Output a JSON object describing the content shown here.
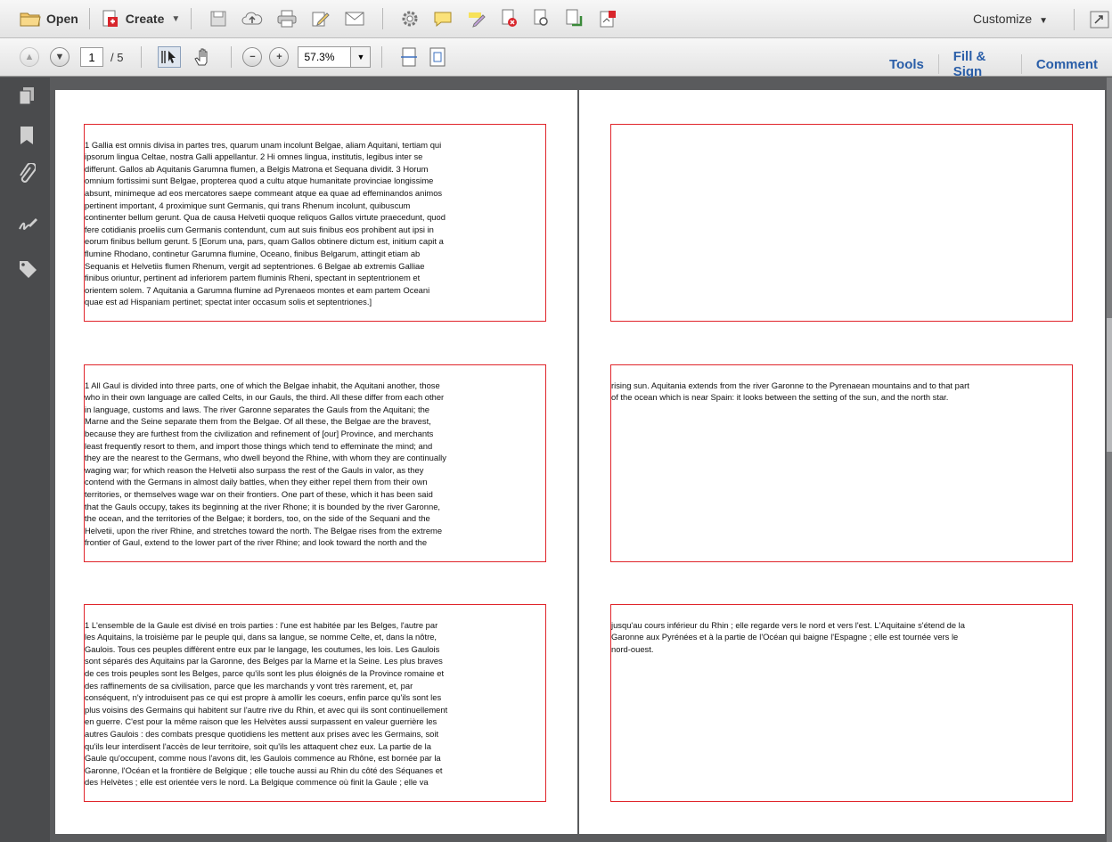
{
  "toolbar": {
    "open_label": "Open",
    "create_label": "Create",
    "customize_label": "Customize"
  },
  "nav": {
    "current_page": "1",
    "total_pages": "/ 5",
    "zoom": "57.3%"
  },
  "panes": {
    "tools": "Tools",
    "fill_sign": "Fill & Sign",
    "comment": "Comment"
  },
  "pages": {
    "left": {
      "latin": "1 Gallia est omnis divisa in partes tres, quarum unam incolunt Belgae, aliam Aquitani, tertiam qui\nipsorum lingua Celtae, nostra Galli appellantur. 2 Hi omnes lingua, institutis, legibus inter se\ndifferunt. Gallos ab Aquitanis Garumna flumen, a Belgis Matrona et Sequana dividit. 3 Horum\nomnium fortissimi sunt Belgae, propterea quod a cultu atque humanitate provinciae longissime\nabsunt, minimeque ad eos mercatores saepe commeant atque ea quae ad effeminandos animos\npertinent important, 4 proximique sunt Germanis, qui trans Rhenum incolunt, quibuscum\ncontinenter bellum gerunt. Qua de causa Helvetii quoque reliquos Gallos virtute praecedunt, quod\nfere cotidianis proeliis cum Germanis contendunt, cum aut suis finibus eos prohibent aut ipsi in\neorum finibus bellum gerunt. 5 [Eorum una, pars, quam Gallos obtinere dictum est, initium capit a\nflumine Rhodano, continetur Garumna flumine, Oceano, finibus Belgarum, attingit etiam ab\nSequanis et Helvetiis flumen Rhenum, vergit ad septentriones. 6 Belgae ab extremis Galliae\nfinibus oriuntur, pertinent ad inferiorem partem fluminis Rheni, spectant in septentrionem et\norientem solem. 7 Aquitania a Garumna flumine ad Pyrenaeos montes et eam partem Oceani\nquae est ad Hispaniam pertinet; spectat inter occasum solis et septentriones.]",
      "english": "1 All Gaul is divided into three parts, one of which the Belgae inhabit, the Aquitani another, those\nwho in their own language are called Celts, in our Gauls, the third. All these differ from each other\nin language, customs and laws. The river Garonne separates the Gauls from the Aquitani; the\nMarne and the Seine separate them from the Belgae. Of all these, the Belgae are the bravest,\nbecause they are furthest from the civilization and refinement of [our] Province, and merchants\nleast frequently resort to them, and import those things which tend to effeminate the mind; and\nthey are the nearest to the Germans, who dwell beyond the Rhine, with whom they are continually\nwaging war; for which reason the Helvetii also surpass the rest of the Gauls in valor, as they\ncontend with the Germans in almost daily battles, when they either repel them from their own\nterritories, or themselves wage war on their frontiers. One part of these, which it has been said\nthat the Gauls occupy, takes its beginning at the river Rhone; it is bounded by the river Garonne,\nthe ocean, and the territories of the Belgae; it borders, too, on the side of the Sequani and the\nHelvetii, upon the river Rhine, and stretches toward the north. The Belgae rises from the extreme\nfrontier of Gaul, extend to the lower part of the river Rhine; and look toward the north and the",
      "french": "1 L'ensemble de la Gaule est divisé en trois parties : l'une est habitée par les Belges, l'autre par\nles Aquitains, la troisième par le peuple qui, dans sa langue, se nomme Celte, et, dans la nôtre,\nGaulois. Tous ces peuples diffèrent entre eux par le langage, les coutumes, les lois. Les Gaulois\nsont séparés des Aquitains par la Garonne, des Belges par la Marne et la Seine. Les plus braves\nde ces trois peuples sont les Belges, parce qu'ils sont les plus éloignés de la Province romaine et\ndes raffinements de sa civilisation, parce que les marchands y vont très rarement, et, par\nconséquent, n'y introduisent pas ce qui est propre à amollir les coeurs, enfin parce qu'ils sont les\nplus voisins des Germains qui habitent sur l'autre rive du Rhin, et avec qui ils sont continuellement\nen guerre. C'est pour la même raison que les Helvètes aussi surpassent en valeur guerrière les\nautres Gaulois : des combats presque quotidiens les mettent aux prises avec les Germains, soit\nqu'ils leur interdisent l'accès de leur territoire, soit qu'ils les attaquent chez eux. La partie de la\nGaule qu'occupent, comme nous l'avons dit, les Gaulois commence au Rhône, est bornée par la\nGaronne, l'Océan et la frontière de Belgique ; elle touche aussi au Rhin du côté des Séquanes et\ndes Helvètes ; elle est orientée vers le nord. La Belgique commence où finit la Gaule ; elle va"
    },
    "right": {
      "latin": "",
      "english": "rising sun. Aquitania extends from the river Garonne to the Pyrenaean mountains and to that part\nof the ocean which is near Spain: it looks between the setting of the sun, and the north star.",
      "french": "jusqu'au cours inférieur du Rhin ; elle regarde vers le nord et vers l'est. L'Aquitaine s'étend de la\nGaronne aux Pyrénées et à la partie de l'Océan qui baigne l'Espagne ; elle est tournée vers le\nnord-ouest."
    }
  },
  "colors": {
    "frame_red": "#e0242a",
    "link_blue": "#2a5ea8",
    "rail": "#4a4b4d",
    "workspace": "#5a5b5d"
  },
  "icons": {
    "toolbar": [
      "folder-icon",
      "create-pdf-icon",
      "save-icon",
      "upload-cloud-icon",
      "print-icon",
      "edit-icon",
      "email-icon",
      "settings-icon",
      "comment-icon",
      "highlight-icon",
      "redact-icon",
      "stamp-icon",
      "export-icon",
      "sign-icon"
    ],
    "rail": [
      "pages-panel-icon",
      "bookmarks-icon",
      "attachments-icon",
      "signatures-icon",
      "tags-icon"
    ]
  }
}
